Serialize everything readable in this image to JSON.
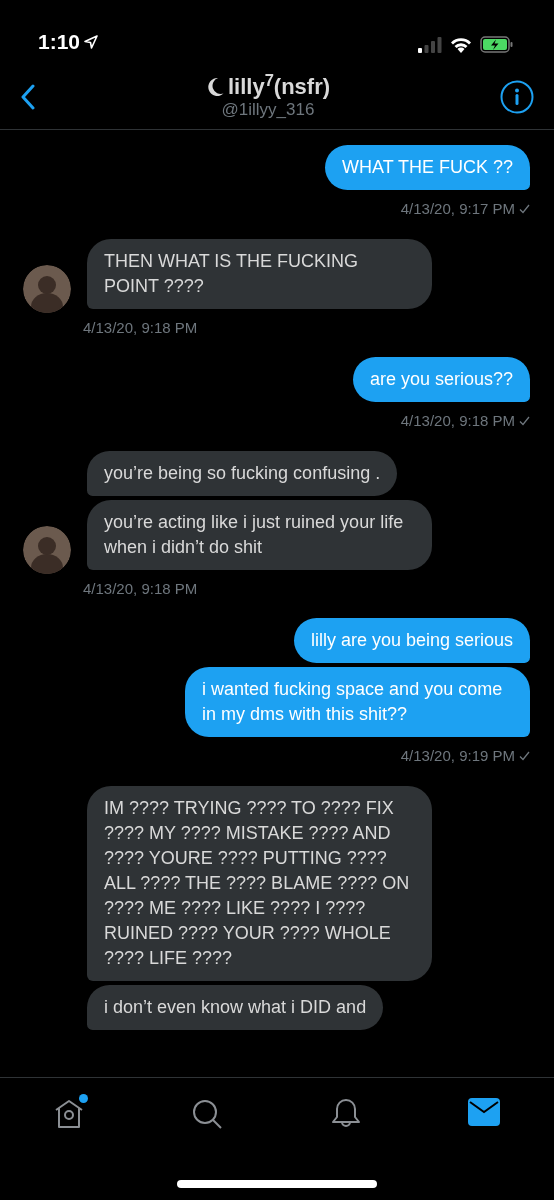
{
  "status_bar": {
    "time": "1:10"
  },
  "header": {
    "name": "lilly$^{7}$(nsfr)",
    "handle": "@1illyy_316"
  },
  "messages": [
    {
      "kind": "outgoing",
      "bubbles": [
        "WHAT THE FUCK ??"
      ],
      "time": "4/13/20, 9:17 PM"
    },
    {
      "kind": "incoming",
      "bubbles": [
        "THEN WHAT IS THE FUCKING POINT ????"
      ],
      "time": "4/13/20, 9:18 PM"
    },
    {
      "kind": "outgoing",
      "bubbles": [
        "are you serious??"
      ],
      "time": "4/13/20, 9:18 PM"
    },
    {
      "kind": "incoming",
      "bubbles": [
        "you’re being so fucking confusing .",
        "you’re acting like i just ruined your life when i didn’t do shit"
      ],
      "time": "4/13/20, 9:18 PM"
    },
    {
      "kind": "outgoing",
      "bubbles": [
        "lilly are you being serious",
        "i wanted fucking space and you come in my dms with this shit??"
      ],
      "time": "4/13/20, 9:19 PM"
    },
    {
      "kind": "incoming",
      "bubbles": [
        "IM ???? TRYING ???? TO ???? FIX ???? MY ???? MISTAKE ???? AND ???? YOURE ???? PUTTING ???? ALL ???? THE ???? BLAME ???? ON ???? ME ???? LIKE ???? I ???? RUINED ???? YOUR ???? WHOLE ???? LIFE ????",
        "i don’t even know what i DID and"
      ]
    }
  ],
  "tabs": [
    {
      "kind": "home",
      "selected": false,
      "dot": true
    },
    {
      "kind": "search",
      "selected": false,
      "dot": false
    },
    {
      "kind": "notifications",
      "selected": false,
      "dot": false
    },
    {
      "kind": "messages",
      "selected": true,
      "dot": false
    }
  ]
}
